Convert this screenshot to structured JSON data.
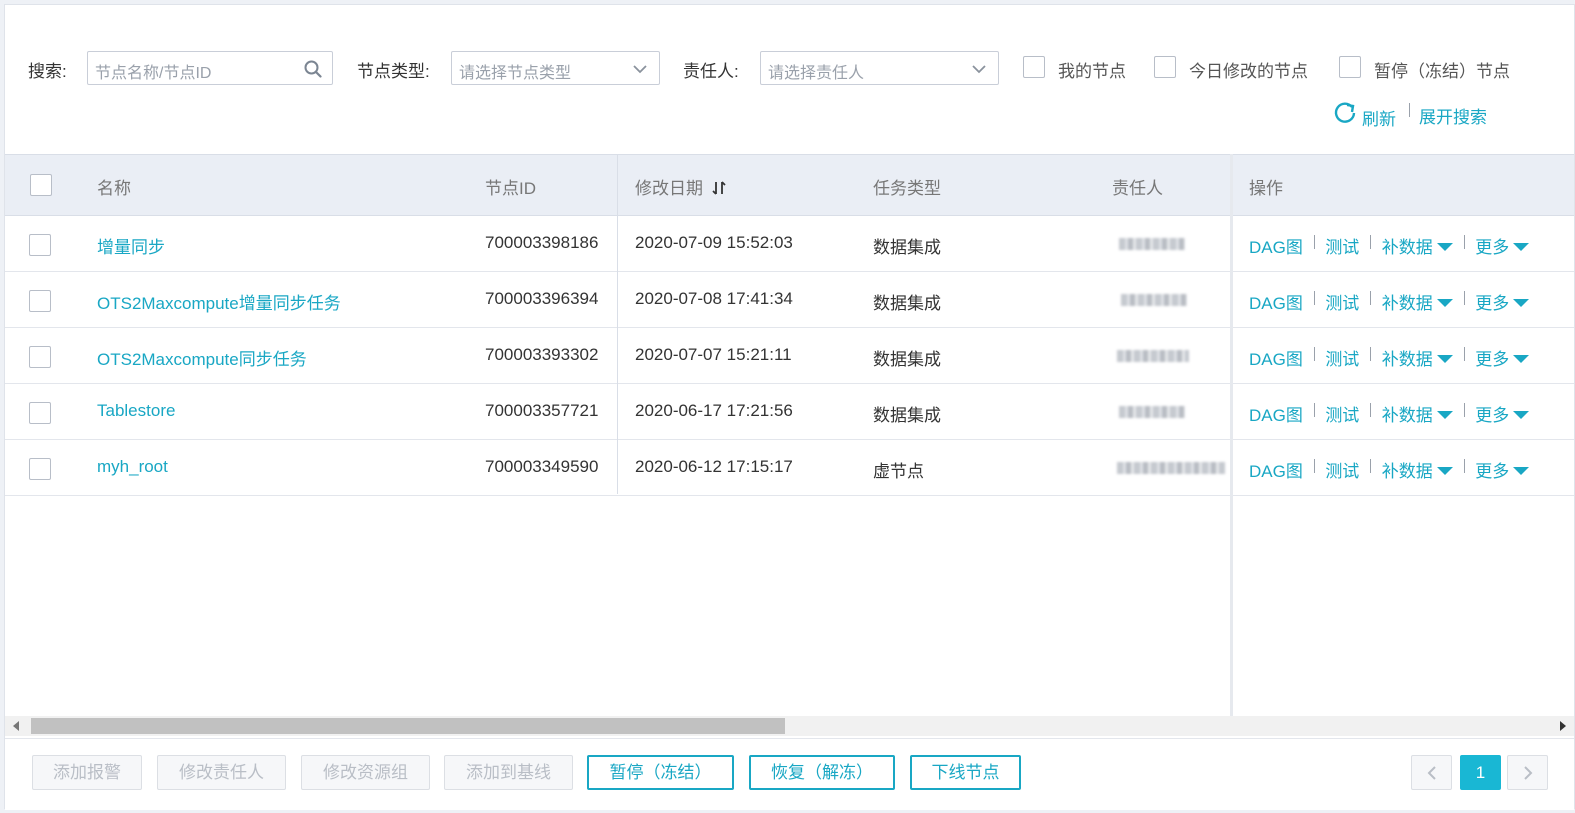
{
  "filters": {
    "search_label": "搜索:",
    "search_placeholder": "节点名称/节点ID",
    "type_label": "节点类型:",
    "type_placeholder": "请选择节点类型",
    "owner_label": "责任人:",
    "owner_placeholder": "请选择责任人",
    "checkboxes": [
      "我的节点",
      "今日修改的节点",
      "暂停（冻结）节点"
    ],
    "refresh_label": "刷新",
    "expand_label": "展开搜索"
  },
  "table": {
    "headers": {
      "name": "名称",
      "node_id": "节点ID",
      "modified": "修改日期",
      "task_type": "任务类型",
      "owner": "责任人",
      "ops": "操作"
    },
    "rows": [
      {
        "name": "增量同步",
        "node_id": "700003398186",
        "modified": "2020-07-09 15:52:03",
        "task_type": "数据集成"
      },
      {
        "name": "OTS2Maxcompute增量同步任务",
        "node_id": "700003396394",
        "modified": "2020-07-08 17:41:34",
        "task_type": "数据集成"
      },
      {
        "name": "OTS2Maxcompute同步任务",
        "node_id": "700003393302",
        "modified": "2020-07-07 15:21:11",
        "task_type": "数据集成"
      },
      {
        "name": "Tablestore",
        "node_id": "700003357721",
        "modified": "2020-06-17 17:21:56",
        "task_type": "数据集成"
      },
      {
        "name": "myh_root",
        "node_id": "700003349590",
        "modified": "2020-06-12 17:15:17",
        "task_type": "虚节点"
      }
    ],
    "ops": {
      "dag": "DAG图",
      "test": "测试",
      "backfill": "补数据",
      "more": "更多"
    }
  },
  "footer": {
    "buttons": [
      "添加报警",
      "修改责任人",
      "修改资源组",
      "添加到基线",
      "暂停（冻结）",
      "恢复（解冻）",
      "下线节点"
    ],
    "page": "1"
  },
  "colors": {
    "accent": "#19a7c4",
    "page_active": "#19b7d4",
    "header_bg": "#eaeef5"
  }
}
